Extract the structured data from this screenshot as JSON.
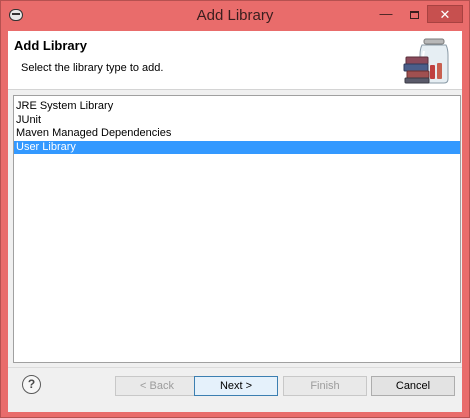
{
  "window": {
    "title": "Add Library",
    "minimize_glyph": "—",
    "close_glyph": "✕",
    "title_bar_color": "#e96c6b"
  },
  "header": {
    "title": "Add Library",
    "description": "Select the library type to add.",
    "graphic_icon": "library-jar-books-icon"
  },
  "library_types": [
    {
      "label": "JRE System Library",
      "selected": false
    },
    {
      "label": "JUnit",
      "selected": false
    },
    {
      "label": "Maven Managed Dependencies",
      "selected": false
    },
    {
      "label": "User Library",
      "selected": true
    }
  ],
  "selection_color": "#3399ff",
  "footer": {
    "help_glyph": "?",
    "back_label": "< Back",
    "next_label": "Next >",
    "finish_label": "Finish",
    "cancel_label": "Cancel",
    "back_enabled": false,
    "finish_enabled": false
  }
}
